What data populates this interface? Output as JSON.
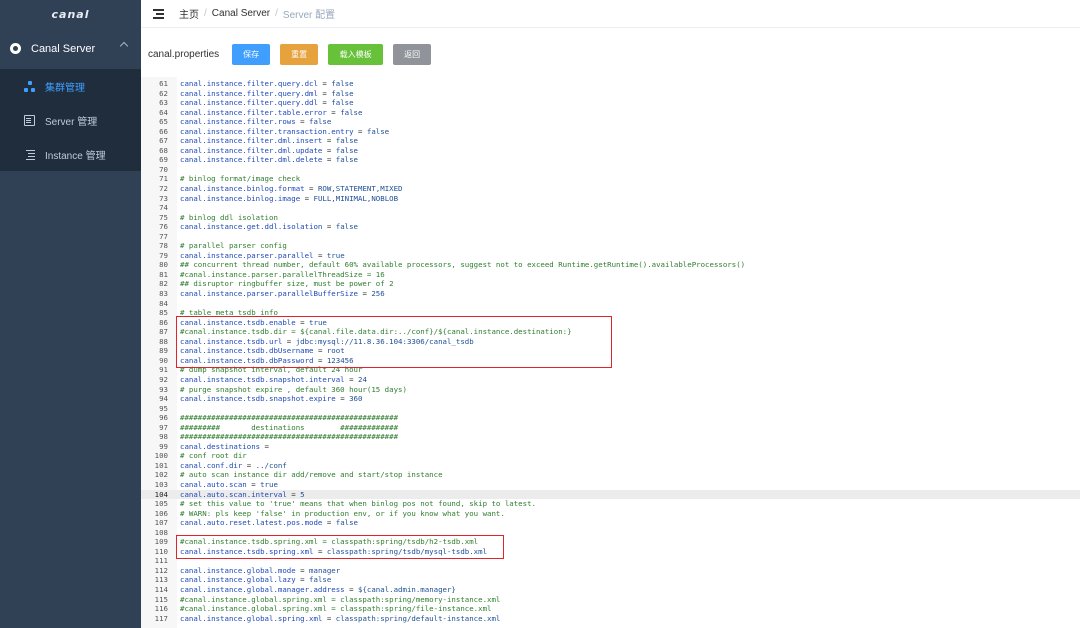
{
  "app": {
    "logo": "canal"
  },
  "sidebar": {
    "group": {
      "label": "Canal Server"
    },
    "items": [
      {
        "label": "集群管理",
        "icon": "cluster-icon",
        "active": true
      },
      {
        "label": "Server 管理",
        "icon": "document-icon",
        "active": false
      },
      {
        "label": "Instance 管理",
        "icon": "list-icon",
        "active": false
      }
    ]
  },
  "header": {
    "breadcrumb": [
      "主页",
      "Canal Server",
      "Server 配置"
    ]
  },
  "toolbar": {
    "file_label": "canal.properties",
    "save_label": "保存",
    "reset_label": "重置",
    "load_label": "载入模板",
    "back_label": "返回"
  },
  "colors": {
    "sidebar_bg": "#304156",
    "submenu_bg": "#1f2d3d",
    "active": "#409eff",
    "save": "#409eff",
    "reset": "#e6a23c",
    "load": "#67c23a",
    "back": "#909399",
    "highlight_box": "#e0242a"
  },
  "editor": {
    "highlighted_line": 104,
    "highlight_boxes": [
      [
        86,
        90
      ],
      [
        109,
        110
      ]
    ],
    "lines": [
      {
        "n": "61",
        "text": "canal.instance.filter.query.dcl = false"
      },
      {
        "n": "62",
        "text": "canal.instance.filter.query.dml = false"
      },
      {
        "n": "63",
        "text": "canal.instance.filter.query.ddl = false"
      },
      {
        "n": "64",
        "text": "canal.instance.filter.table.error = false"
      },
      {
        "n": "65",
        "text": "canal.instance.filter.rows = false"
      },
      {
        "n": "66",
        "text": "canal.instance.filter.transaction.entry = false"
      },
      {
        "n": "67",
        "text": "canal.instance.filter.dml.insert = false"
      },
      {
        "n": "68",
        "text": "canal.instance.filter.dml.update = false"
      },
      {
        "n": "69",
        "text": "canal.instance.filter.dml.delete = false"
      },
      {
        "n": "70",
        "text": ""
      },
      {
        "n": "71",
        "text": "# binlog format/image check"
      },
      {
        "n": "72",
        "text": "canal.instance.binlog.format = ROW,STATEMENT,MIXED"
      },
      {
        "n": "73",
        "text": "canal.instance.binlog.image = FULL,MINIMAL,NOBLOB"
      },
      {
        "n": "74",
        "text": ""
      },
      {
        "n": "75",
        "text": "# binlog ddl isolation"
      },
      {
        "n": "76",
        "text": "canal.instance.get.ddl.isolation = false"
      },
      {
        "n": "77",
        "text": ""
      },
      {
        "n": "78",
        "text": "# parallel parser config"
      },
      {
        "n": "79",
        "text": "canal.instance.parser.parallel = true"
      },
      {
        "n": "80",
        "text": "## concurrent thread number, default 60% available processors, suggest not to exceed Runtime.getRuntime().availableProcessors()"
      },
      {
        "n": "81",
        "text": "#canal.instance.parser.parallelThreadSize = 16"
      },
      {
        "n": "82",
        "text": "## disruptor ringbuffer size, must be power of 2"
      },
      {
        "n": "83",
        "text": "canal.instance.parser.parallelBufferSize = 256"
      },
      {
        "n": "84",
        "text": ""
      },
      {
        "n": "85",
        "text": "# table meta tsdb info"
      },
      {
        "n": "86",
        "text": "canal.instance.tsdb.enable = true"
      },
      {
        "n": "87",
        "text": "#canal.instance.tsdb.dir = ${canal.file.data.dir:../conf}/${canal.instance.destination:}"
      },
      {
        "n": "88",
        "text": "canal.instance.tsdb.url = jdbc:mysql://11.8.36.104:3306/canal_tsdb"
      },
      {
        "n": "89",
        "text": "canal.instance.tsdb.dbUsername = root"
      },
      {
        "n": "90",
        "text": "canal.instance.tsdb.dbPassword = 123456"
      },
      {
        "n": "91",
        "text": "# dump snapshot interval, default 24 hour"
      },
      {
        "n": "92",
        "text": "canal.instance.tsdb.snapshot.interval = 24"
      },
      {
        "n": "93",
        "text": "# purge snapshot expire , default 360 hour(15 days)"
      },
      {
        "n": "94",
        "text": "canal.instance.tsdb.snapshot.expire = 360"
      },
      {
        "n": "95",
        "text": ""
      },
      {
        "n": "96",
        "text": "#################################################"
      },
      {
        "n": "97",
        "text": "#########       destinations        #############"
      },
      {
        "n": "98",
        "text": "#################################################"
      },
      {
        "n": "99",
        "text": "canal.destinations ="
      },
      {
        "n": "100",
        "text": "# conf root dir"
      },
      {
        "n": "101",
        "text": "canal.conf.dir = ../conf"
      },
      {
        "n": "102",
        "text": "# auto scan instance dir add/remove and start/stop instance"
      },
      {
        "n": "103",
        "text": "canal.auto.scan = true"
      },
      {
        "n": "104",
        "text": "canal.auto.scan.interval = 5"
      },
      {
        "n": "105",
        "text": "# set this value to 'true' means that when binlog pos not found, skip to latest."
      },
      {
        "n": "106",
        "text": "# WARN: pls keep 'false' in production env, or if you know what you want."
      },
      {
        "n": "107",
        "text": "canal.auto.reset.latest.pos.mode = false"
      },
      {
        "n": "108",
        "text": ""
      },
      {
        "n": "109",
        "text": "#canal.instance.tsdb.spring.xml = classpath:spring/tsdb/h2-tsdb.xml"
      },
      {
        "n": "110",
        "text": "canal.instance.tsdb.spring.xml = classpath:spring/tsdb/mysql-tsdb.xml"
      },
      {
        "n": "111",
        "text": ""
      },
      {
        "n": "112",
        "text": "canal.instance.global.mode = manager"
      },
      {
        "n": "113",
        "text": "canal.instance.global.lazy = false"
      },
      {
        "n": "114",
        "text": "canal.instance.global.manager.address = ${canal.admin.manager}"
      },
      {
        "n": "115",
        "text": "#canal.instance.global.spring.xml = classpath:spring/memory-instance.xml"
      },
      {
        "n": "116",
        "text": "#canal.instance.global.spring.xml = classpath:spring/file-instance.xml"
      },
      {
        "n": "117",
        "text": "canal.instance.global.spring.xml = classpath:spring/default-instance.xml"
      }
    ]
  }
}
